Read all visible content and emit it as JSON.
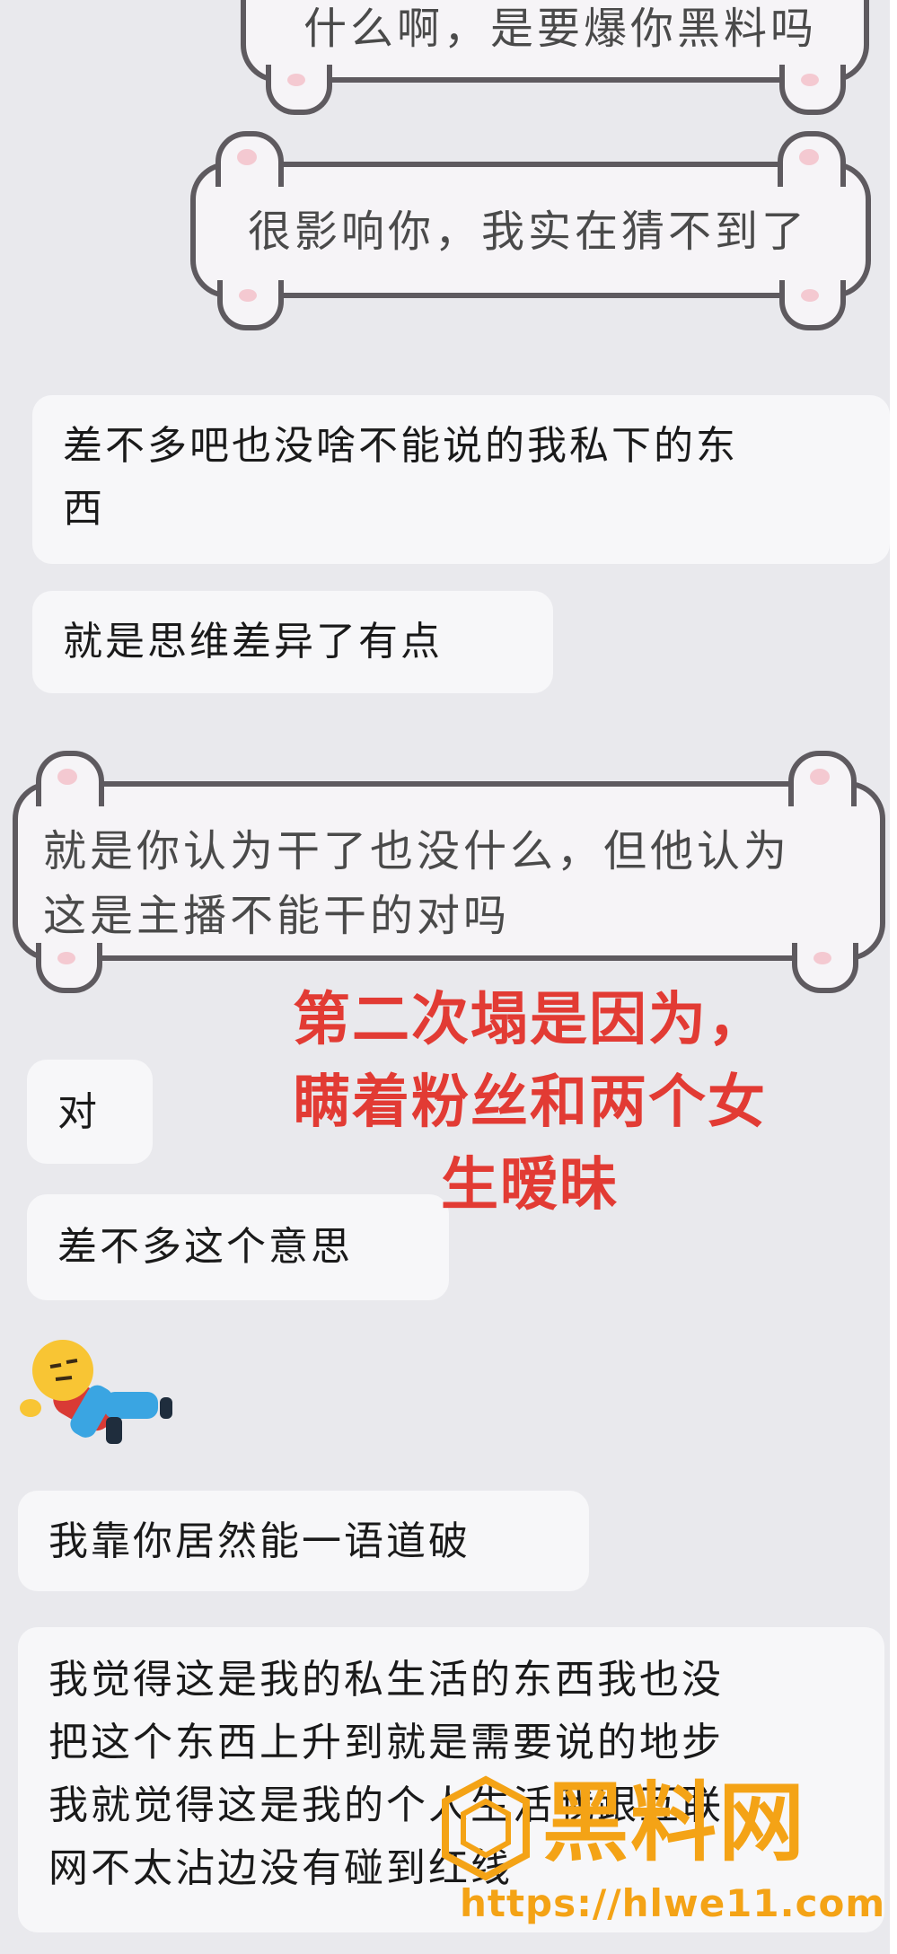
{
  "chat": {
    "cat_messages": [
      "什么啊，是要爆你黑料吗",
      "很影响你，我实在猜不到了",
      "就是你认为干了也没什么，但他认为",
      "这是主播不能干的对吗"
    ],
    "messages": [
      "差不多吧也没啥不能说的我私下的东",
      "西",
      "就是思维差异了有点",
      "对",
      "差不多这个意思",
      "我靠你居然能一语道破",
      "我觉得这是我的私生活的东西我也没",
      "把这个东西上升到就是需要说的地步",
      "我就觉得这是我的个人生活我跟互联",
      "网不太沾边没有碰到红线"
    ]
  },
  "overlay": {
    "lines": [
      "第二次塌是因为，",
      "瞒着粉丝和两个女",
      "生暧昧"
    ],
    "color": "#e23b34"
  },
  "watermark": {
    "title": "黑料网",
    "url": "https://hlwe11.com",
    "color": "#f4a316"
  }
}
